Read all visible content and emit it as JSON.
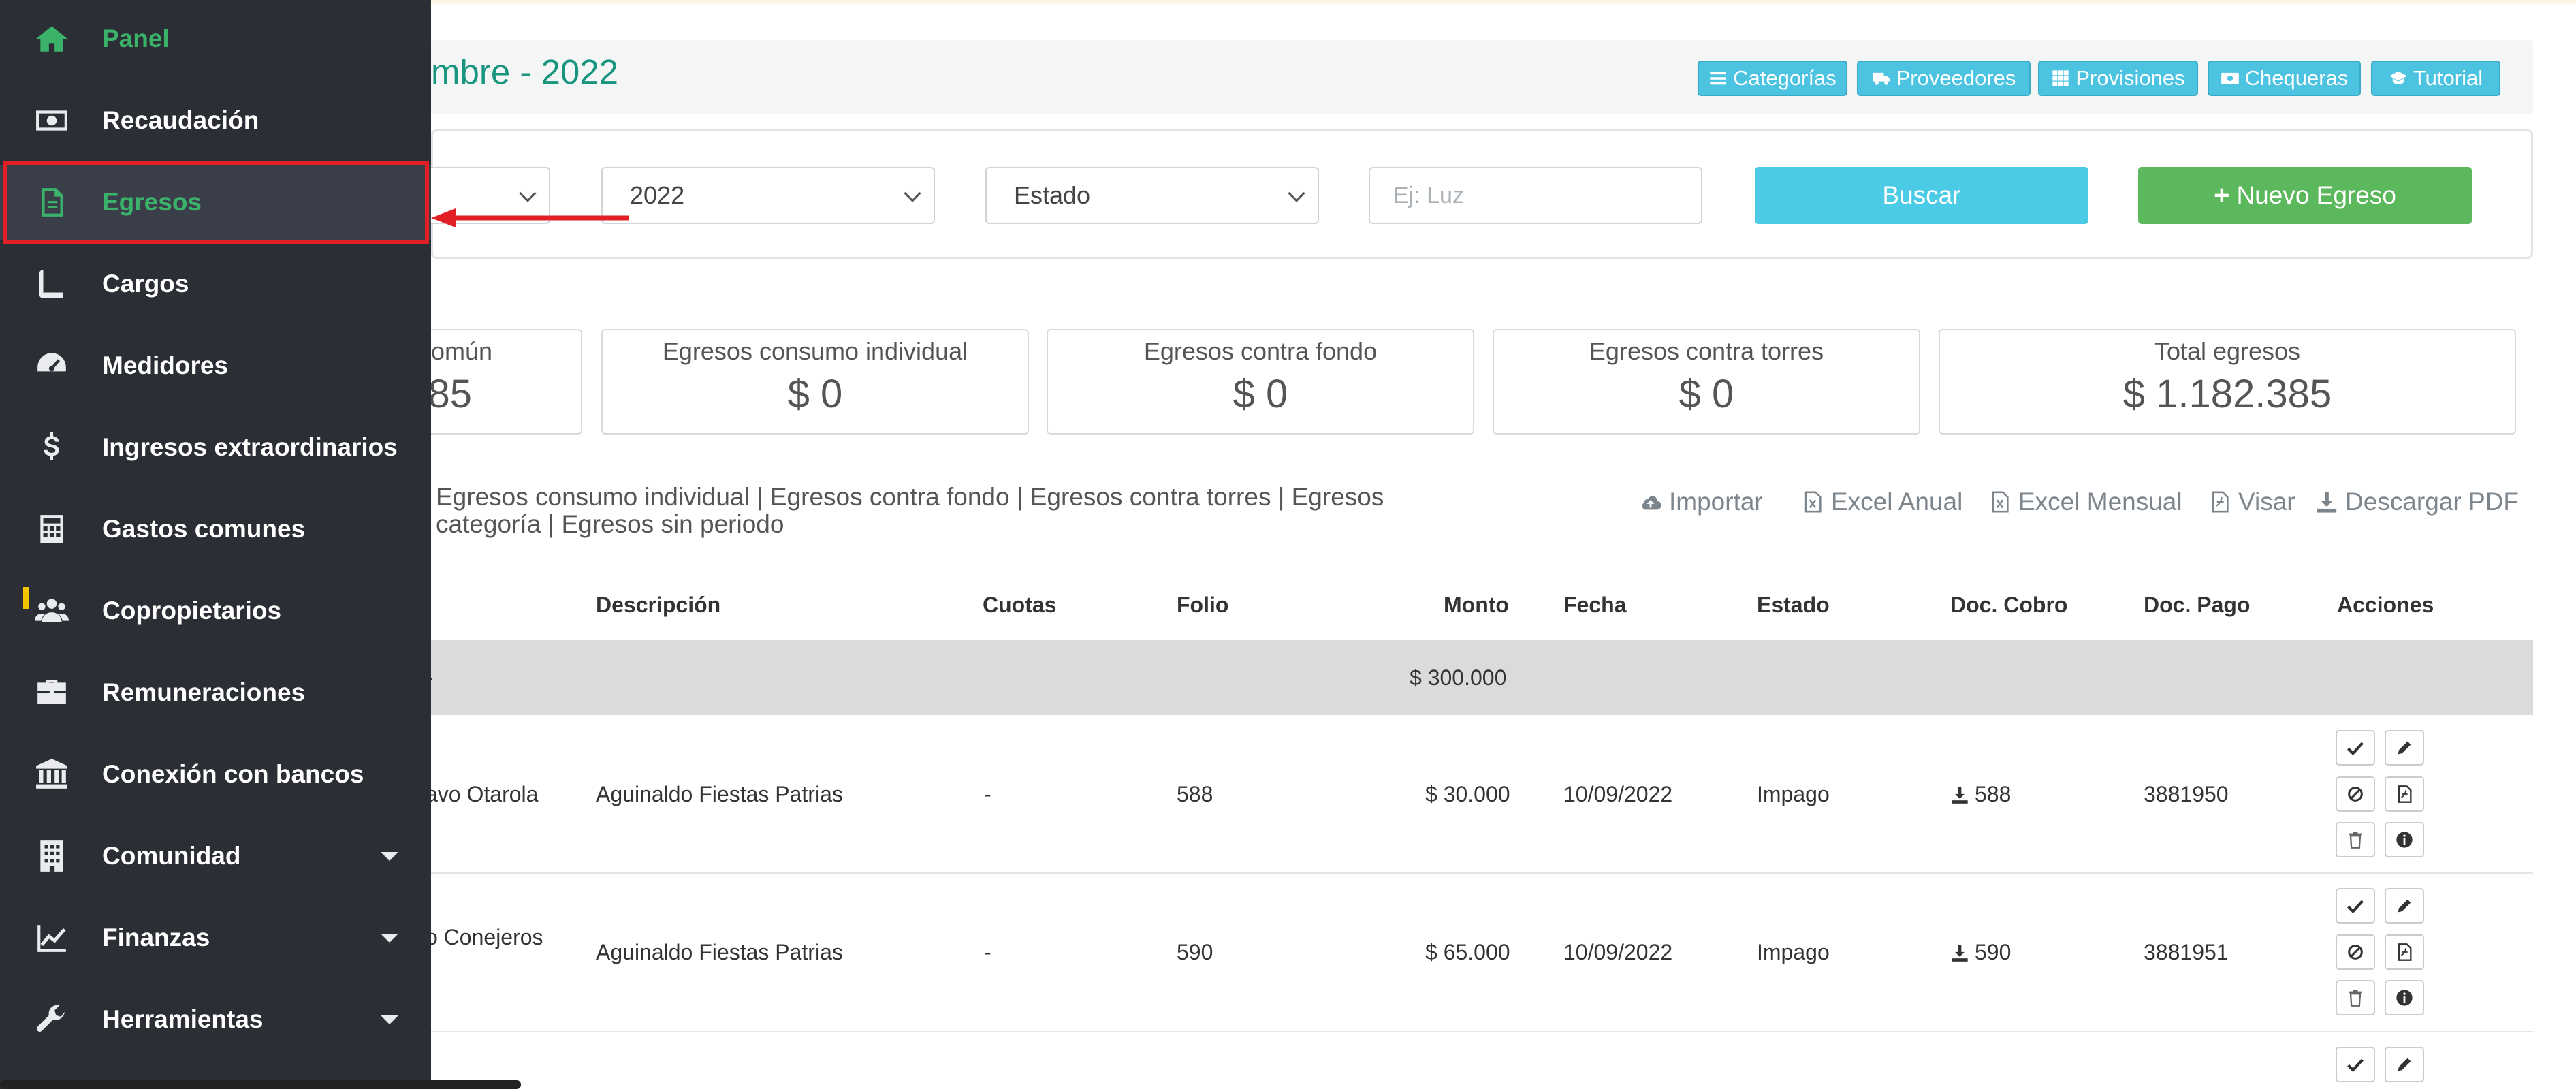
{
  "sidebar": {
    "items": [
      {
        "label": "Panel",
        "icon": "home-icon"
      },
      {
        "label": "Recaudación",
        "icon": "money-icon"
      },
      {
        "label": "Egresos",
        "icon": "file-text-icon"
      },
      {
        "label": "Cargos",
        "icon": "book-icon"
      },
      {
        "label": "Medidores",
        "icon": "gauge-icon"
      },
      {
        "label": "Ingresos extraordinarios",
        "icon": "dollar-icon"
      },
      {
        "label": "Gastos comunes",
        "icon": "calculator-icon"
      },
      {
        "label": "Copropietarios",
        "icon": "users-icon"
      },
      {
        "label": "Remuneraciones",
        "icon": "briefcase-icon"
      },
      {
        "label": "Conexión con bancos",
        "icon": "bank-icon"
      },
      {
        "label": "Comunidad",
        "icon": "building-icon"
      },
      {
        "label": "Finanzas",
        "icon": "line-chart-icon"
      },
      {
        "label": "Herramientas",
        "icon": "wrench-icon"
      }
    ]
  },
  "header": {
    "title": "mbre - 2022",
    "buttons": {
      "categorias": "Categorías",
      "proveedores": "Proveedores",
      "provisiones": "Provisiones",
      "chequeras": "Chequeras",
      "tutorial": "Tutorial"
    }
  },
  "filters": {
    "year": "2022",
    "estado": "Estado",
    "search_placeholder": "Ej: Luz",
    "buscar": "Buscar",
    "nuevo": "Nuevo Egreso"
  },
  "cards": {
    "c0_title": "omún",
    "c0_value": "85",
    "c1_title": "Egresos consumo individual",
    "c1_value": "$ 0",
    "c2_title": "Egresos contra fondo",
    "c2_value": "$ 0",
    "c3_title": "Egresos contra torres",
    "c3_value": "$ 0",
    "c4_title": "Total egresos",
    "c4_value": "$ 1.182.385"
  },
  "links": {
    "line1": "Egresos consumo individual | Egresos contra fondo | Egresos contra torres | Egresos",
    "line2": "categoría | Egresos sin periodo"
  },
  "tools": {
    "importar": "Importar",
    "excel_anual": "Excel Anual",
    "excel_mensual": "Excel Mensual",
    "visar": "Visar",
    "pdf": "Descargar PDF"
  },
  "table": {
    "headers": {
      "descripcion": "Descripción",
      "cuotas": "Cuotas",
      "folio": "Folio",
      "monto": "Monto",
      "fecha": "Fecha",
      "estado": "Estado",
      "doc_cobro": "Doc. Cobro",
      "doc_pago": "Doc. Pago",
      "acciones": "Acciones"
    },
    "group": {
      "marker": "-",
      "total": "$ 300.000"
    },
    "rows": [
      {
        "name": "avo Otarola",
        "descripcion": "Aguinaldo Fiestas Patrias",
        "cuotas": "-",
        "folio": "588",
        "monto": "$ 30.000",
        "fecha": "10/09/2022",
        "estado": "Impago",
        "doc_cobro": "588",
        "doc_pago": "3881950"
      },
      {
        "name": "o Conejeros",
        "descripcion": "Aguinaldo Fiestas Patrias",
        "cuotas": "-",
        "folio": "590",
        "monto": "$ 65.000",
        "fecha": "10/09/2022",
        "estado": "Impago",
        "doc_cobro": "590",
        "doc_pago": "3881951"
      }
    ]
  },
  "colors": {
    "sidebar_bg": "#2b2e35",
    "accent_green": "#3bb26a",
    "title_teal": "#17957f",
    "info_blue": "#4cc3e0",
    "success_green": "#5cb85c",
    "highlight_red": "#e01f26"
  }
}
